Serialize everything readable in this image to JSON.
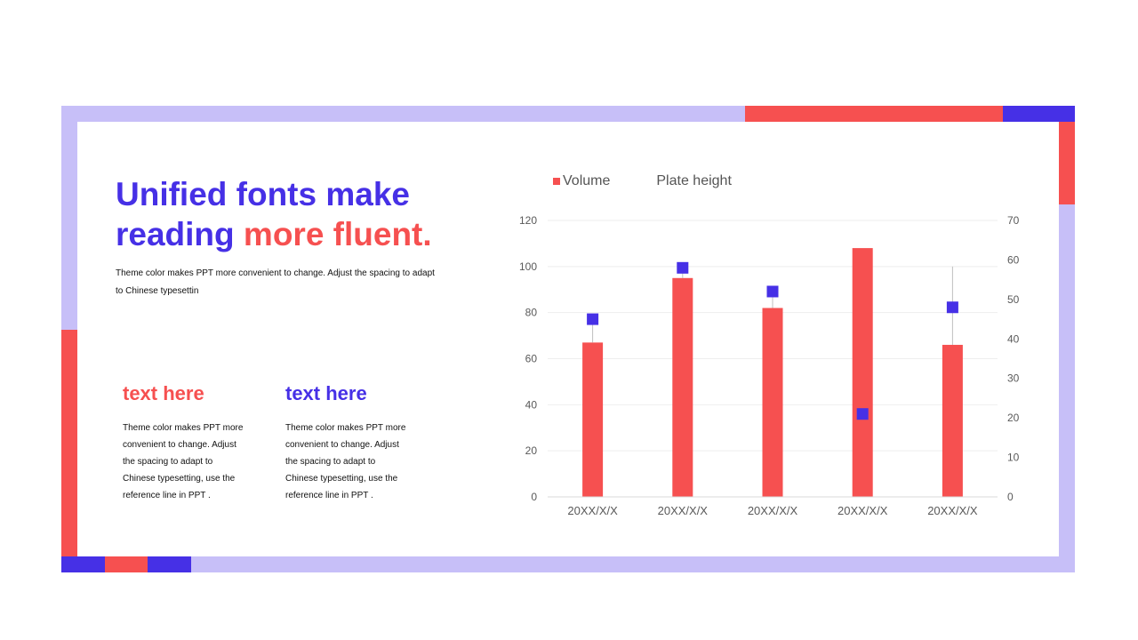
{
  "slide": {
    "title_part1": "Unified fonts make reading ",
    "title_accent": "more fluent.",
    "subtitle": "Theme color makes PPT more convenient to change. Adjust the spacing to adapt to Chinese typesettin",
    "columns": [
      {
        "heading": "text here",
        "body": "Theme color makes PPT more convenient to change. Adjust the spacing to adapt to Chinese typesetting, use the reference line in PPT ."
      },
      {
        "heading": "text here",
        "body": "Theme color makes PPT more convenient to change. Adjust the spacing to adapt to Chinese typesetting, use the reference line in PPT ."
      }
    ]
  },
  "colors": {
    "accent_red": "#f65050",
    "accent_blue": "#4630e6",
    "frame": "#c7bff8"
  },
  "chart_data": {
    "type": "bar",
    "categories": [
      "20XX/X/X",
      "20XX/X/X",
      "20XX/X/X",
      "20XX/X/X",
      "20XX/X/X"
    ],
    "series": [
      {
        "name": "Volume",
        "type": "bar",
        "axis": "left",
        "color": "#f65050",
        "values": [
          67,
          95,
          82,
          108,
          66
        ]
      },
      {
        "name": "Plate height",
        "type": "scatter",
        "axis": "right",
        "color": "#4630e6",
        "values": [
          45,
          58,
          52,
          21,
          48
        ]
      }
    ],
    "ylim": [
      0,
      120
    ],
    "yticks": [
      0,
      20,
      40,
      60,
      80,
      100,
      120
    ],
    "y2lim": [
      0,
      70
    ],
    "y2ticks": [
      0,
      10,
      20,
      30,
      40,
      50,
      60,
      70
    ],
    "legend": [
      "Volume",
      "Plate height"
    ],
    "legend_position": "top-left",
    "grid": true
  }
}
